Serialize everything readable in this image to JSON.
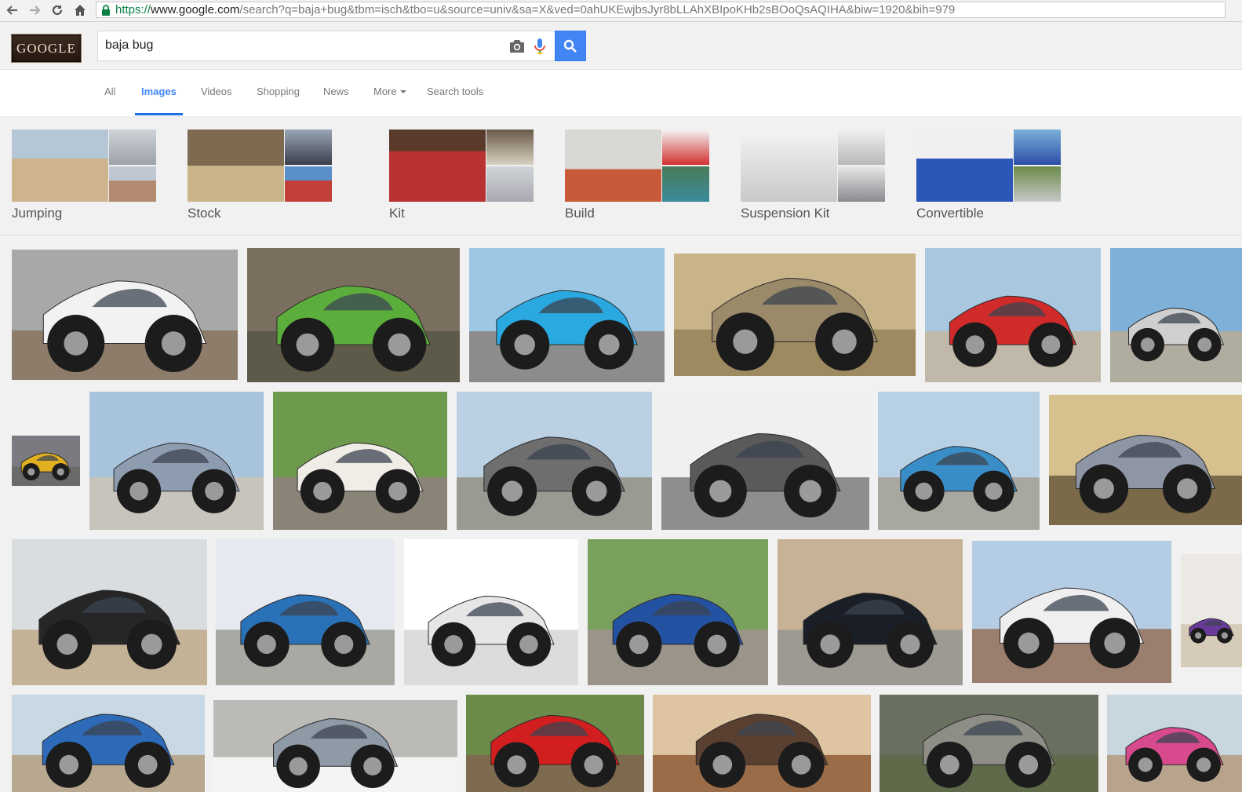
{
  "browser": {
    "url_scheme": "https://",
    "url_host": "www.google.com",
    "url_rest": "/search?q=baja+bug&tbm=isch&tbo=u&source=univ&sa=X&ved=0ahUKEwjbsJyr8bLLAhXBIpoKHb2sBOoQsAQIHA&biw=1920&bih=979"
  },
  "header": {
    "logo_text": "GOOGLE",
    "query": "baja bug"
  },
  "tabs": [
    {
      "label": "All"
    },
    {
      "label": "Images"
    },
    {
      "label": "Videos"
    },
    {
      "label": "Shopping"
    },
    {
      "label": "News"
    },
    {
      "label": "More"
    },
    {
      "label": "Search tools"
    }
  ],
  "related": [
    {
      "label": "Jumping"
    },
    {
      "label": "Stock"
    },
    {
      "label": "Kit"
    },
    {
      "label": "Build"
    },
    {
      "label": "Suspension Kit"
    },
    {
      "label": "Convertible"
    }
  ],
  "colors": {
    "accent": "#4285f4",
    "background": "#f1f1f1"
  },
  "results": [
    {
      "bg": "#a8a9a6",
      "ground": "#8e7c6a",
      "car": "#f2f2f2"
    },
    {
      "bg": "#7a6e5e",
      "ground": "#5e5a4a",
      "car": "#5cae3c"
    },
    {
      "bg": "#9cc8e6",
      "ground": "#8c8c8c",
      "car": "#2aa8e0"
    },
    {
      "bg": "#c9b48a",
      "ground": "#9e8a60",
      "car": "#9a8a6a"
    },
    {
      "bg": "#a9c8e0",
      "ground": "#c0b8a8",
      "car": "#d12a2a"
    },
    {
      "bg": "#7fb0d8",
      "ground": "#b0aca0",
      "car": "#cfcfcf"
    },
    {
      "bg": "#7a7a80",
      "ground": "#6a6a6a",
      "car": "#e0b020"
    },
    {
      "bg": "#a8c4dc",
      "ground": "#c8c4bc",
      "car": "#8e9cb0"
    },
    {
      "bg": "#6e9a4e",
      "ground": "#8a8478",
      "car": "#f0ece6"
    },
    {
      "bg": "#bcd0e4",
      "ground": "#9a9a92",
      "car": "#6e6e6e"
    },
    {
      "bg": "#eef0f2",
      "ground": "#8e8e8e",
      "car": "#5a5a5a"
    },
    {
      "bg": "#b8d0e4",
      "ground": "#a8a8a0",
      "car": "#3a8ec8"
    },
    {
      "bg": "#d6c08e",
      "ground": "#7a6a4a",
      "car": "#8e96a6"
    },
    {
      "bg": "#d9dde0",
      "ground": "#c4b296",
      "car": "#262626"
    },
    {
      "bg": "#e6eaf0",
      "ground": "#aaa8a2",
      "car": "#2a72b8"
    },
    {
      "bg": "#ffffff",
      "ground": "#dcdcdc",
      "car": "#e6e6e6"
    },
    {
      "bg": "#7aa05e",
      "ground": "#9a948a",
      "car": "#2452a2"
    },
    {
      "bg": "#c8b296",
      "ground": "#9c9a92",
      "car": "#1a1e26"
    },
    {
      "bg": "#b4cce4",
      "ground": "#9a7e6e",
      "car": "#efefef"
    },
    {
      "bg": "#ece8e4",
      "ground": "#d6cab8",
      "car": "#6a3a9a"
    },
    {
      "bg": "#c8d8e4",
      "ground": "#b8a890",
      "car": "#2d6ab8"
    },
    {
      "bg": "#bcbab6",
      "ground": "#f4f4f4",
      "car": "#8e9aa6"
    },
    {
      "bg": "#6c8a4a",
      "ground": "#7e6a4e",
      "car": "#d21e1e"
    },
    {
      "bg": "#dec4a0",
      "ground": "#9a6c48",
      "car": "#5a4030"
    },
    {
      "bg": "#6a7060",
      "ground": "#5e6a4a",
      "car": "#8e8e86"
    },
    {
      "bg": "#c8d6e0",
      "ground": "#b8a48c",
      "car": "#d84a8e"
    }
  ]
}
